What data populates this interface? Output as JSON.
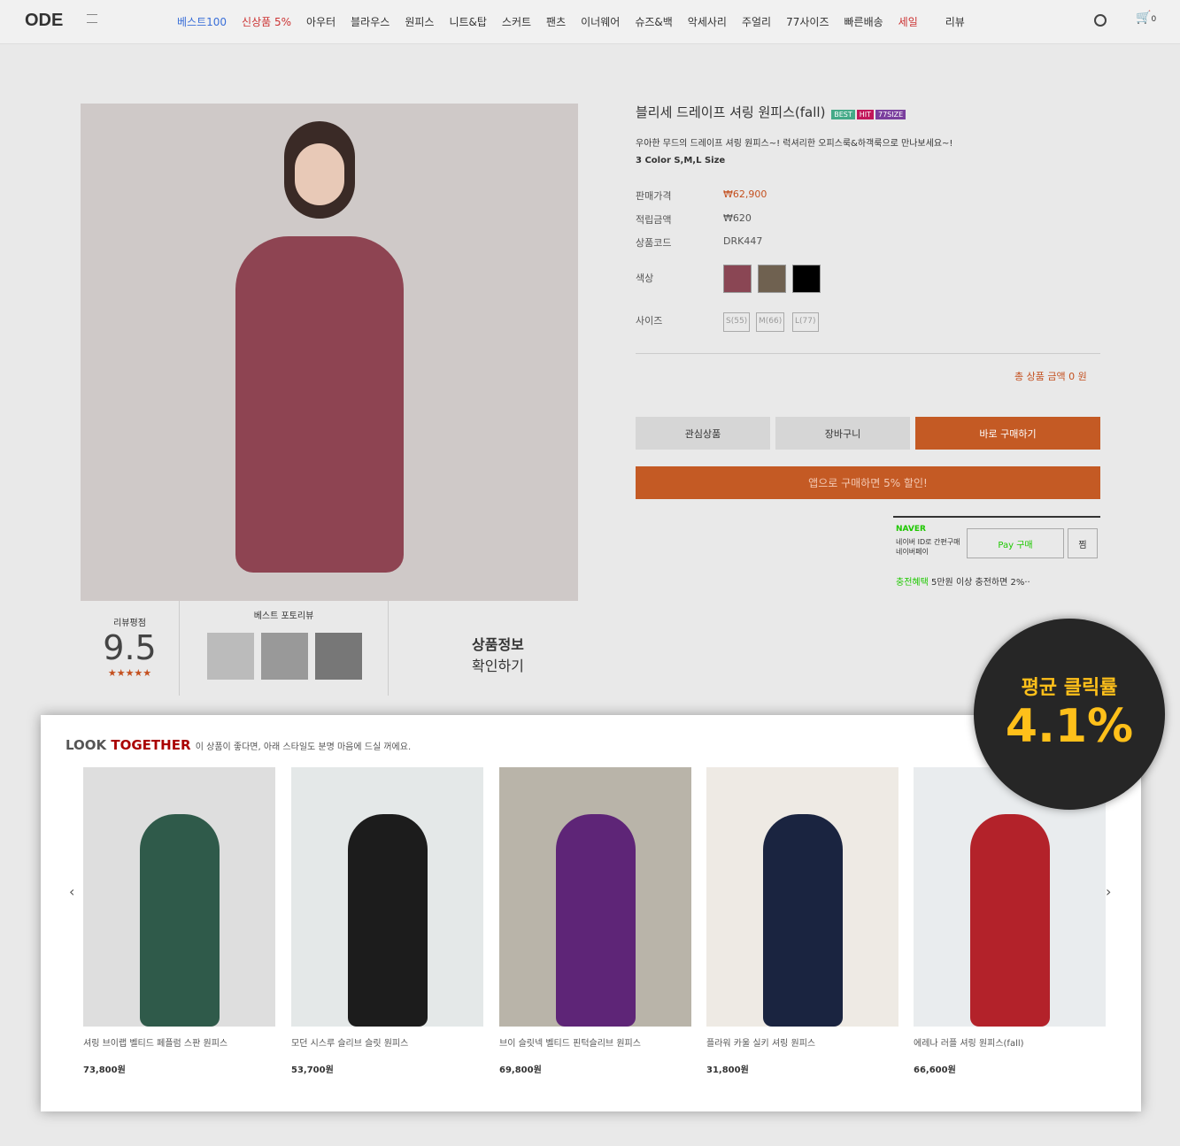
{
  "logo": "ODE",
  "nav": [
    "베스트100",
    "신상품 5%",
    "아우터",
    "블라우스",
    "원피스",
    "니트&탑",
    "스커트",
    "팬츠",
    "이너웨어",
    "슈즈&백",
    "악세사리",
    "주얼리",
    "77사이즈",
    "빠른배송",
    "세일",
    "리뷰"
  ],
  "cart_count": "0",
  "product": {
    "title": "블리세 드레이프 셔링 원피스(fall)",
    "badges": [
      "BEST",
      "HIT",
      "77SIZE"
    ],
    "desc1": "우아한 무드의 드레이프 셔링 원피스~! 럭셔리한 오피스룩&하객룩으로 만나보세요~!",
    "desc2": "3 Color S,M,L Size",
    "price_label": "판매가격",
    "price": "₩62,900",
    "points_label": "적립금액",
    "points": "₩620",
    "code_label": "상품코드",
    "code": "DRK447",
    "color_label": "색상",
    "size_label": "사이즈",
    "sizes": [
      "S(55)",
      "M(66)",
      "L(77)"
    ],
    "total": "총 상품 금액 0 원",
    "wish": "관심상품",
    "cart": "장바구니",
    "buy": "바로 구매하기",
    "app": "앱으로 구매하면 5% 할인!"
  },
  "naver": {
    "brand": "NAVER",
    "sub": "네이버 ID로 간편구매 네이버페이",
    "pay": "Pay 구매",
    "zzim": "찜",
    "benefit": "충전혜택",
    "benefit_text": "5만원 이상 충전하면 2%··"
  },
  "review": {
    "score_label": "리뷰평점",
    "score": "9.5",
    "stars": "★★★★★",
    "photo_label": "베스트 포토리뷰",
    "info1": "상품정보",
    "info2": "확인하기"
  },
  "look": {
    "title1": "LOOK ",
    "title2": "TOGETHER",
    "sub": "이 상품이 좋다면, 아래 스타일도 분명 마음에 드실 꺼에요.",
    "items": [
      {
        "name": "셔링 브이랩 벨티드 페플럼 스판 원피스",
        "price": "73,800원"
      },
      {
        "name": "모던 시스루 슬리브 슬릿 원피스",
        "price": "53,700원"
      },
      {
        "name": "브이 슬릿넥 벨티드 핀턱슬리브 원피스",
        "price": "69,800원"
      },
      {
        "name": "플라워 카울 실키 셔링 원피스",
        "price": "31,800원"
      },
      {
        "name": "에레나 러플 셔링 원피스(fall)",
        "price": "66,600원"
      }
    ]
  },
  "ctr": {
    "label": "평균 클릭률",
    "value": "4.1%"
  }
}
